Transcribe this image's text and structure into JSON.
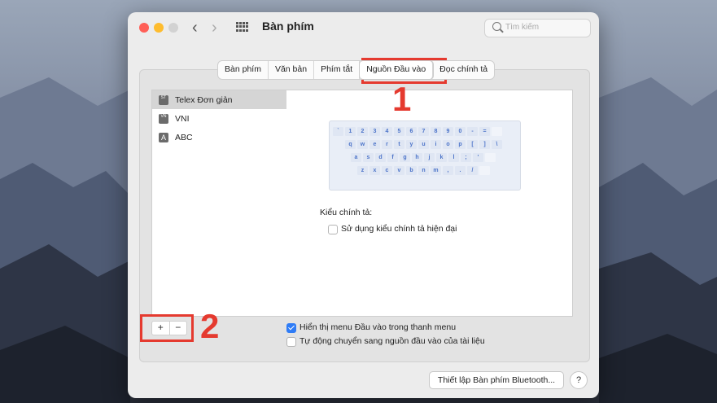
{
  "window": {
    "title": "Bàn phím",
    "search_placeholder": "Tìm kiếm",
    "nav_back": "‹",
    "nav_forward": "›"
  },
  "tabs": [
    {
      "label": "Bàn phím",
      "active": false
    },
    {
      "label": "Văn bản",
      "active": false
    },
    {
      "label": "Phím tắt",
      "active": false
    },
    {
      "label": "Nguồn Đầu vào",
      "active": true
    },
    {
      "label": "Đọc chính tả",
      "active": false
    }
  ],
  "input_sources": [
    {
      "label": "Telex Đơn giản",
      "icon": "vi-st-icon",
      "icon_text": "ST",
      "selected": true
    },
    {
      "label": "VNI",
      "icon": "vi-vn-icon",
      "icon_text": "VN",
      "selected": false
    },
    {
      "label": "ABC",
      "icon": "abc-icon",
      "icon_text": "A",
      "selected": false
    }
  ],
  "keyboard": {
    "row1": [
      "`",
      "1",
      "2",
      "3",
      "4",
      "5",
      "6",
      "7",
      "8",
      "9",
      "0",
      "-",
      "=",
      ""
    ],
    "row2": [
      "q",
      "w",
      "e",
      "r",
      "t",
      "y",
      "u",
      "i",
      "o",
      "p",
      "[",
      "]",
      "\\"
    ],
    "row3": [
      "a",
      "s",
      "d",
      "f",
      "g",
      "h",
      "j",
      "k",
      "l",
      ";",
      "'",
      ""
    ],
    "row4": [
      "z",
      "x",
      "c",
      "v",
      "b",
      "n",
      "m",
      ",",
      ".",
      "/",
      ""
    ]
  },
  "spelling": {
    "label": "Kiểu chính tả:",
    "modern_option": "Sử dụng kiểu chính tả hiện đại",
    "modern_checked": false
  },
  "list_controls": {
    "add": "+",
    "remove": "−"
  },
  "options": {
    "show_menu": "Hiển thị menu Đầu vào trong thanh menu",
    "show_menu_checked": true,
    "auto_switch": "Tự động chuyển sang nguồn đầu vào của tài liệu",
    "auto_switch_checked": false
  },
  "footer": {
    "bluetooth_button": "Thiết lập Bàn phím Bluetooth...",
    "help": "?"
  },
  "annotations": {
    "label_1": "1",
    "label_2": "2"
  },
  "colors": {
    "highlight": "#e53a2f",
    "accent": "#2f7cf6"
  }
}
